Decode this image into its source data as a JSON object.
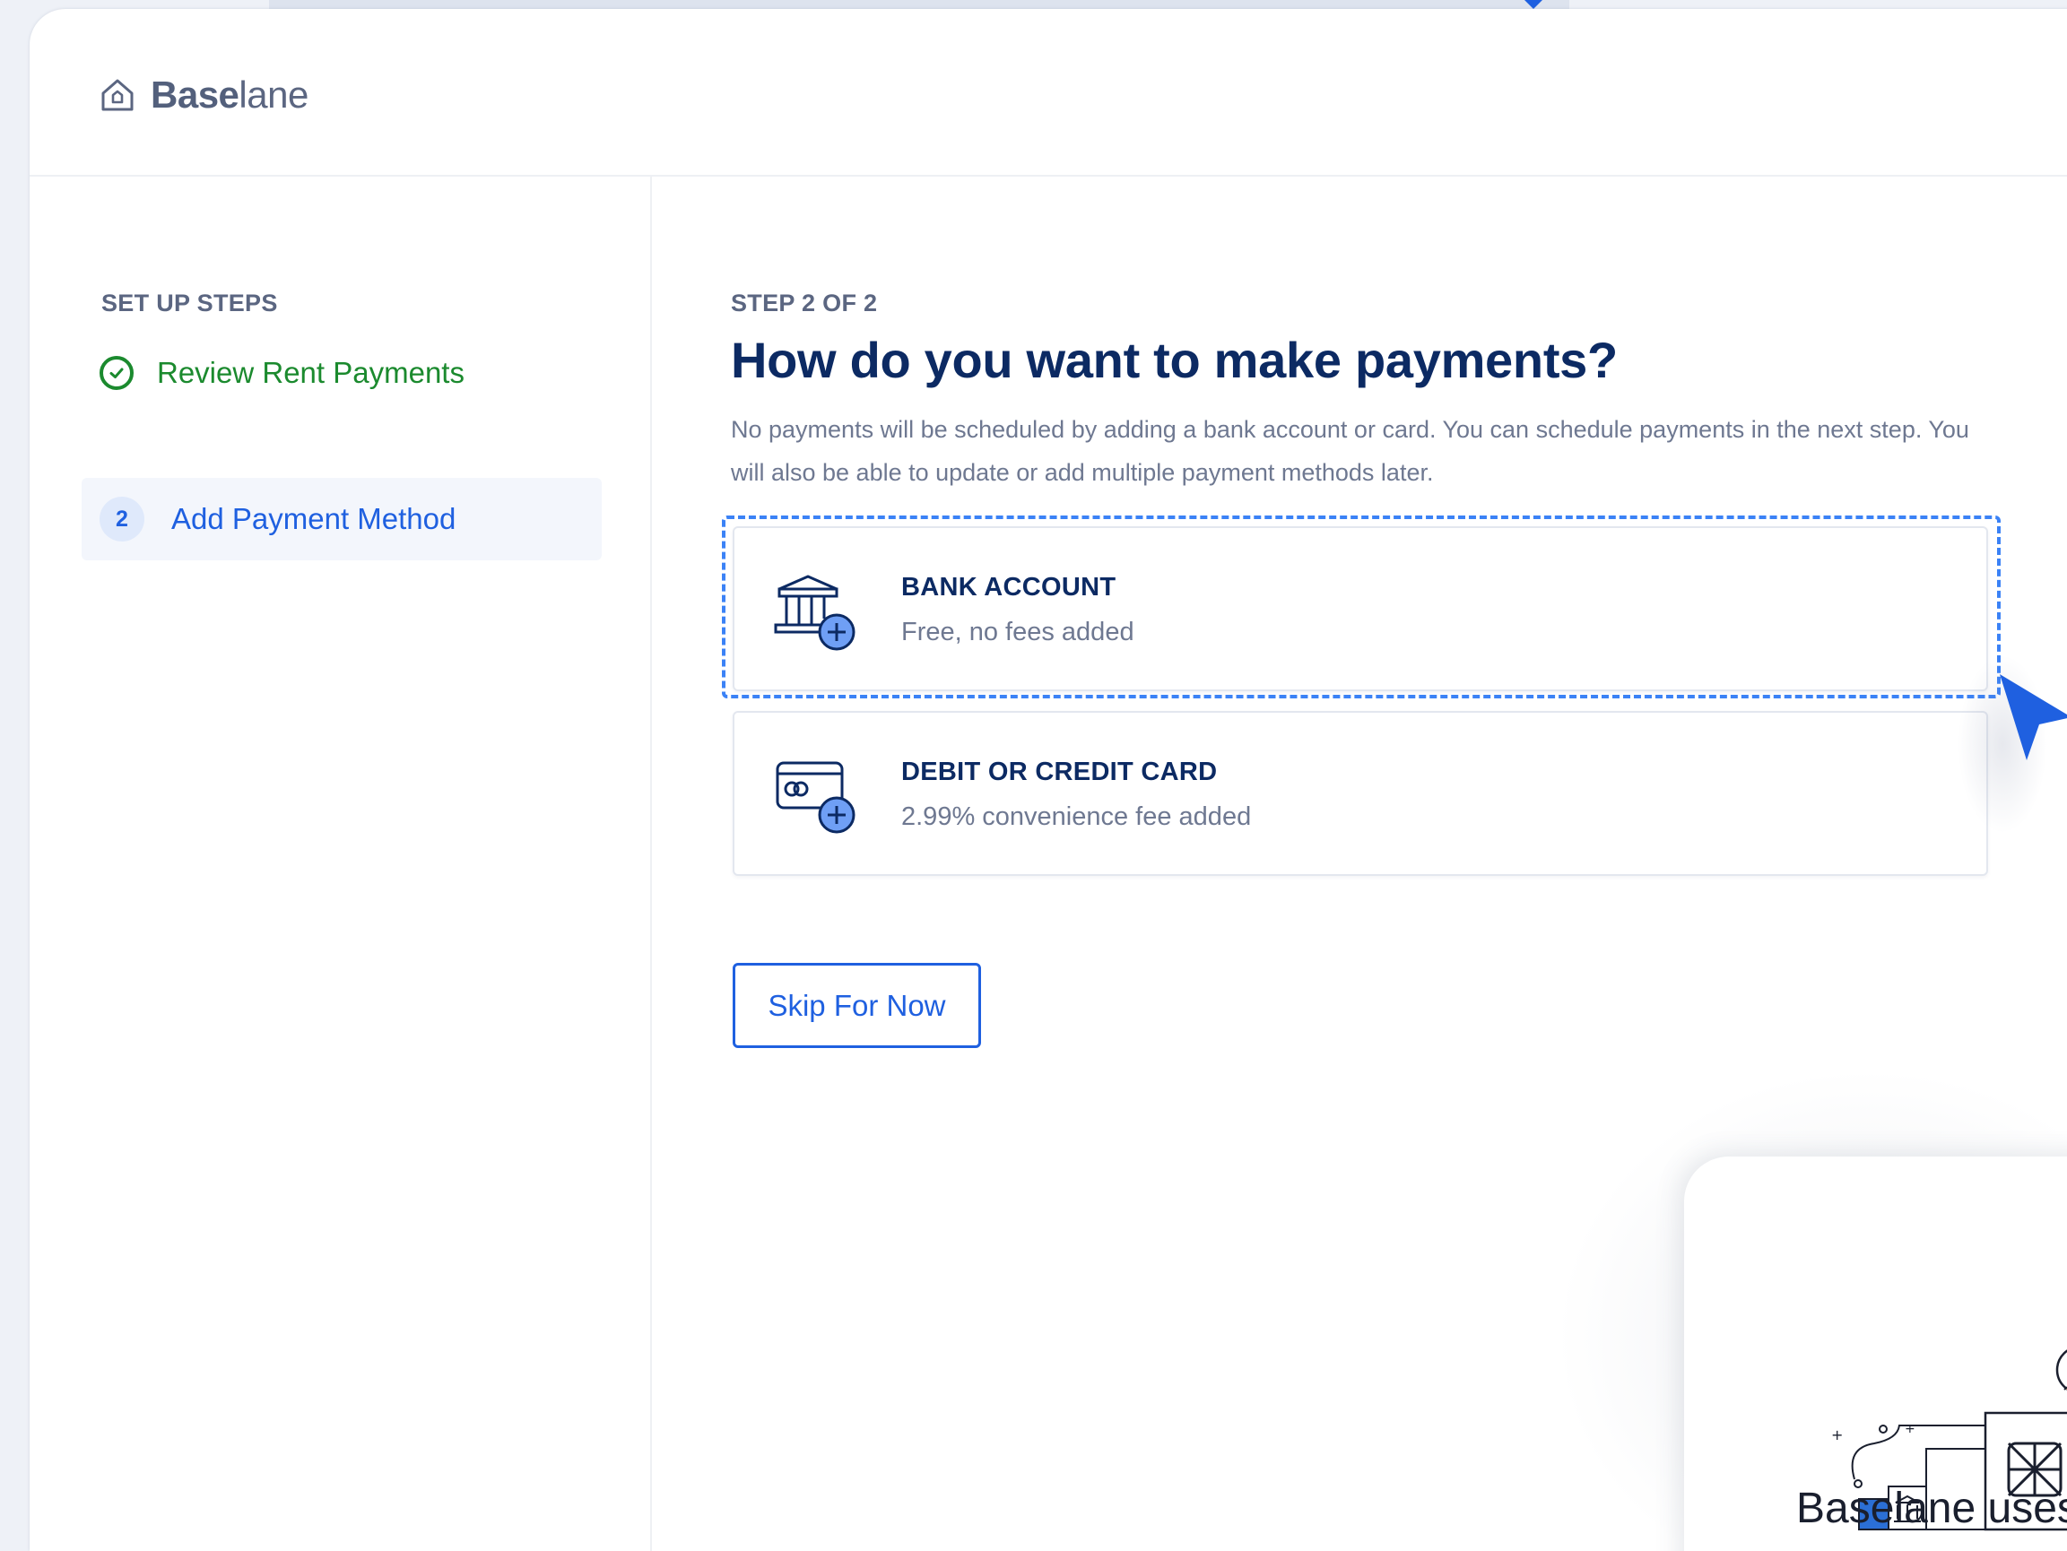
{
  "app": {
    "brand": {
      "bold": "Base",
      "light": "lane"
    },
    "logo_icon": "home-icon"
  },
  "sidebar": {
    "heading": "SET UP STEPS",
    "steps": [
      {
        "label": "Review Rent Payments",
        "status": "complete",
        "icon": "check-circle-icon"
      },
      {
        "number": "2",
        "label": "Add Payment Method",
        "status": "active"
      }
    ]
  },
  "main": {
    "step_indicator": "STEP 2 OF 2",
    "title": "How do you want to make payments?",
    "description": "No payments will be scheduled by adding a bank account or card. You can schedule payments in the next step. You will also be able to update or add multiple payment methods later.",
    "options": [
      {
        "title": "BANK ACCOUNT",
        "subtitle": "Free, no fees added",
        "icon": "bank-add-icon"
      },
      {
        "title": "DEBIT OR CREDIT CARD",
        "subtitle": "2.99% convenience fee added",
        "icon": "card-add-icon"
      }
    ],
    "skip_label": "Skip For Now"
  },
  "modal": {
    "text": "Baselane uses"
  },
  "colors": {
    "primary": "#1f60e0",
    "navy": "#0c2a63",
    "success": "#1b8a2e",
    "muted": "#6e7891",
    "teal": "#3ed6a5"
  }
}
